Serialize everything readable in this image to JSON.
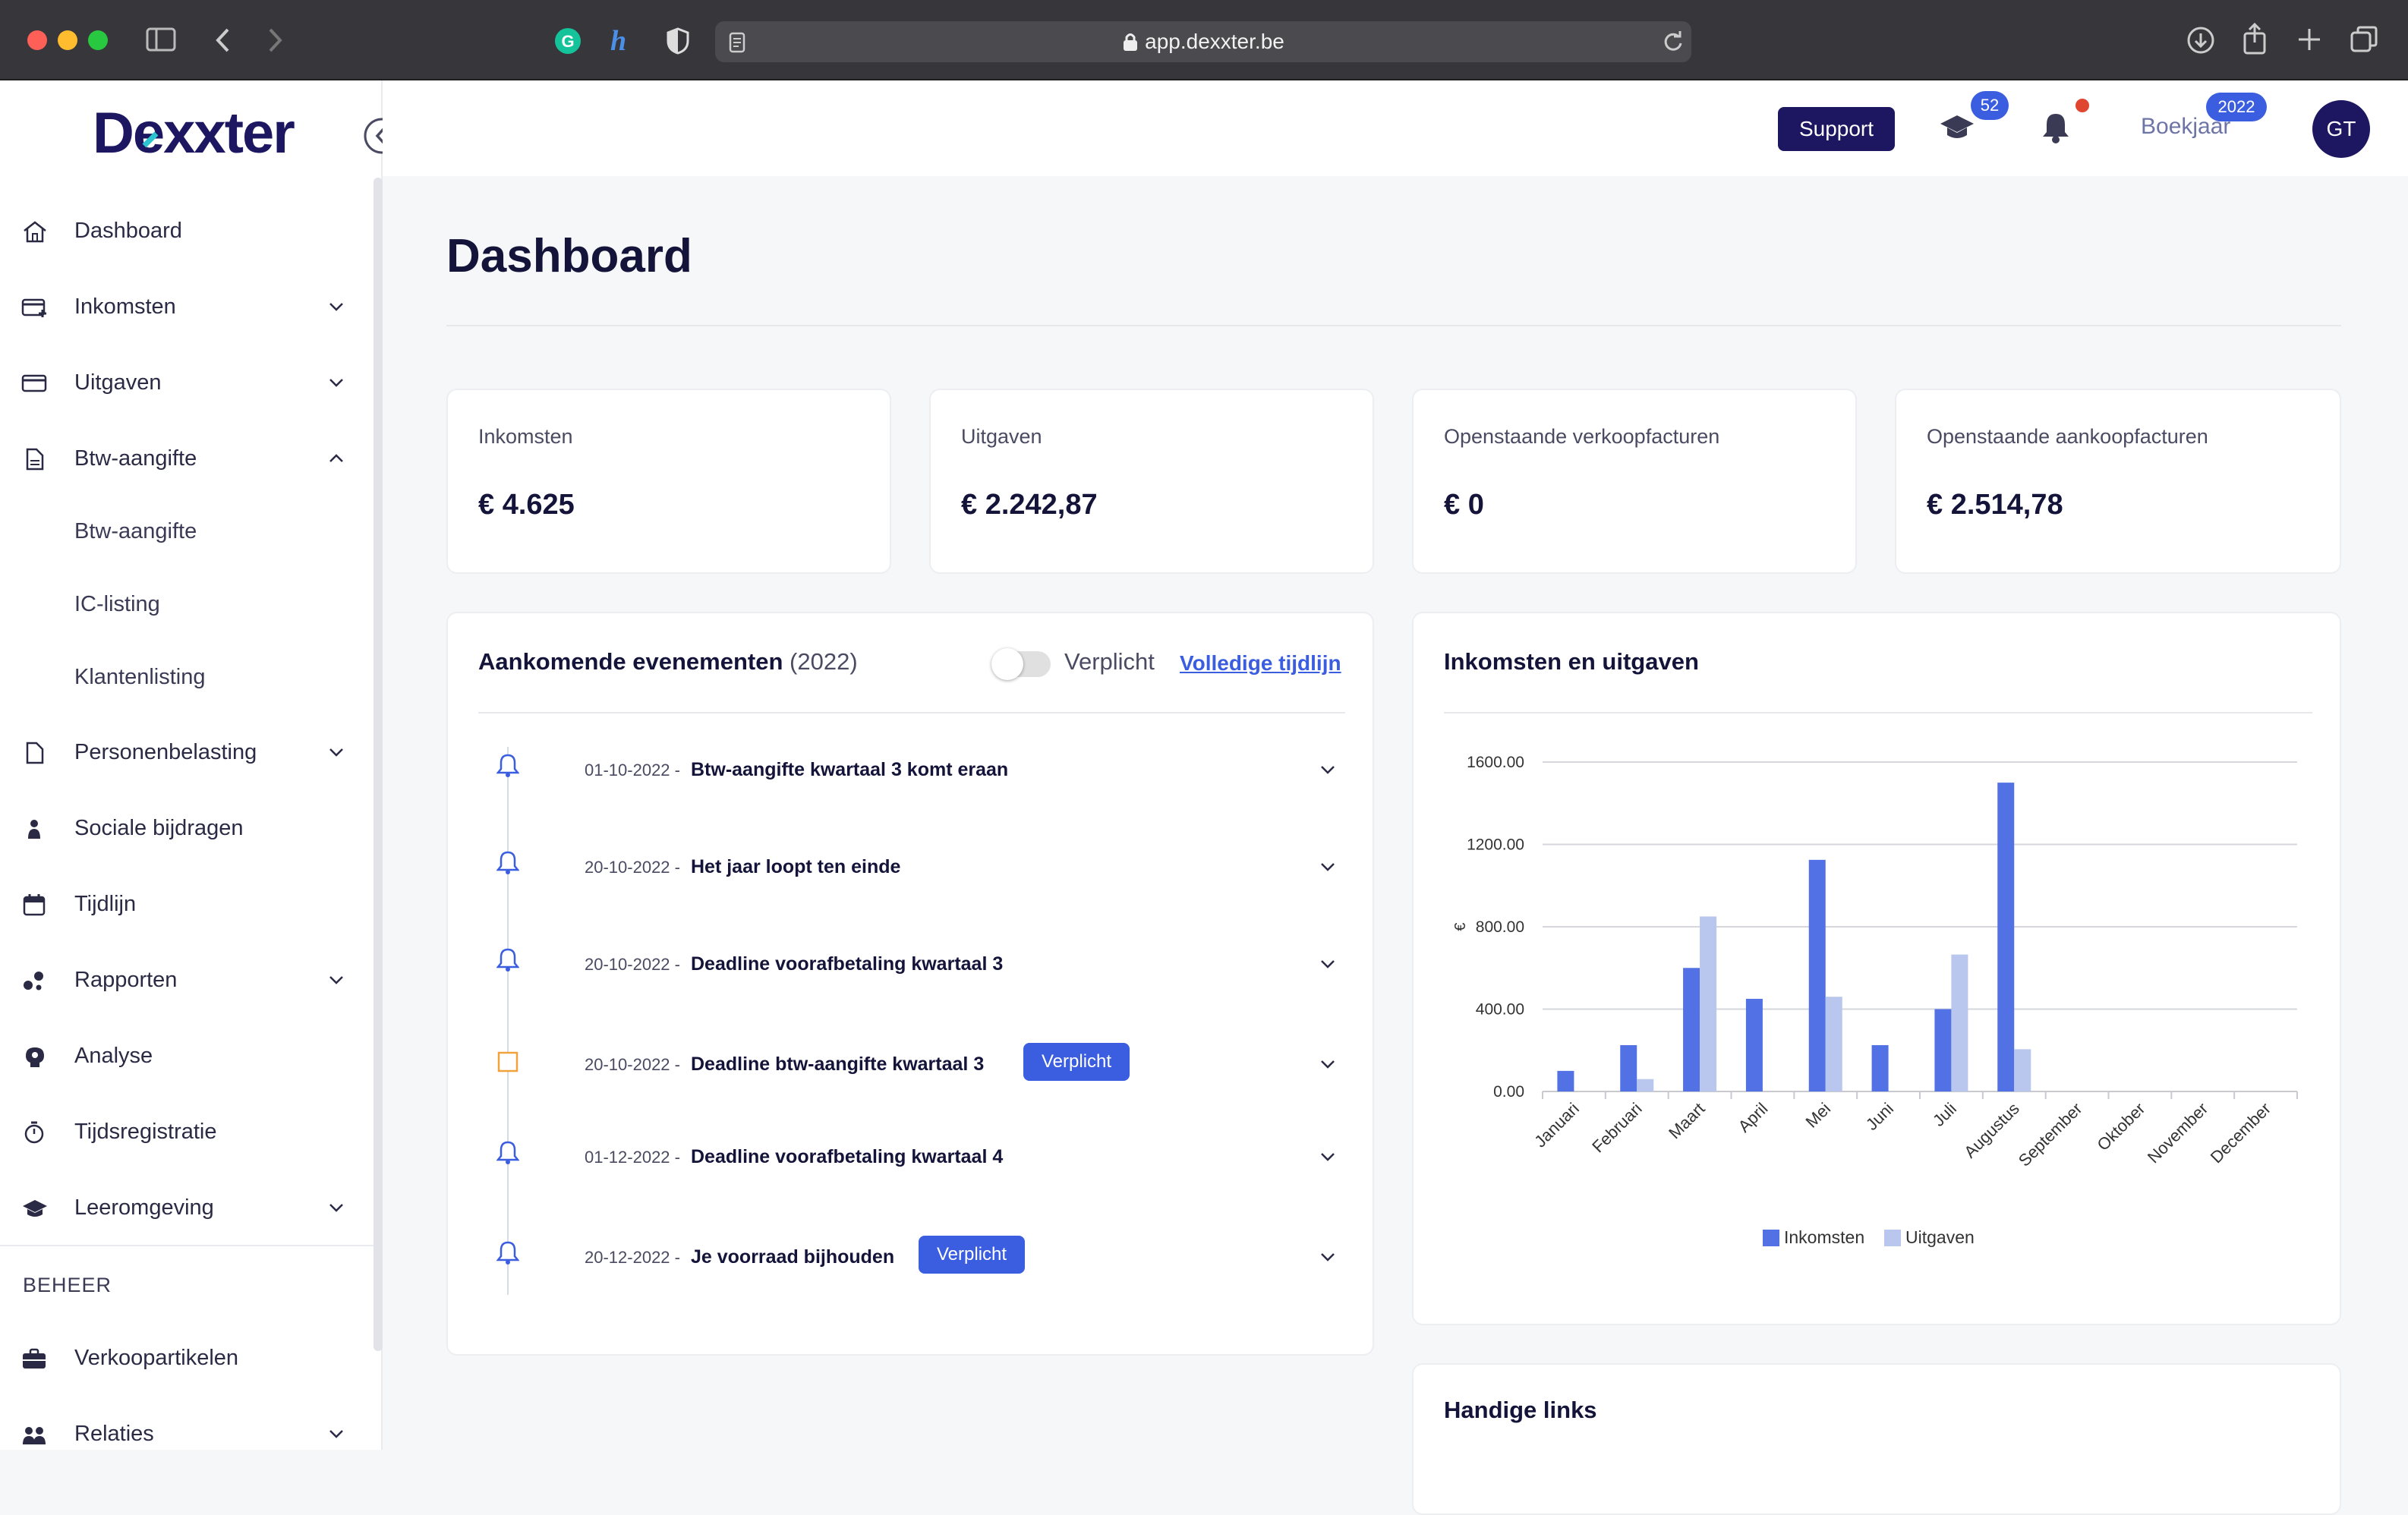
{
  "browser": {
    "url": "app.dexxter.be"
  },
  "brand": {
    "logo_text": "Dexxter",
    "colors": {
      "primary": "#1c1760",
      "accent": "#3b5ee0",
      "light_series": "#b9c6ee",
      "alert": "#e0452f",
      "teal": "#2cc4d0"
    }
  },
  "header": {
    "support_label": "Support",
    "learning_badge": "52",
    "bookyear_label": "Boekjaar",
    "bookyear_badge": "2022",
    "avatar_initials": "GT"
  },
  "sidebar": {
    "items": [
      {
        "label": "Dashboard",
        "icon": "home-icon"
      },
      {
        "label": "Inkomsten",
        "icon": "income-icon"
      },
      {
        "label": "Uitgaven",
        "icon": "card-icon"
      },
      {
        "label": "Btw-aangifte",
        "icon": "document-icon"
      },
      {
        "label": "Personenbelasting",
        "icon": "document-icon"
      },
      {
        "label": "Sociale bijdragen",
        "icon": "person-icon"
      },
      {
        "label": "Tijdlijn",
        "icon": "calendar-icon"
      },
      {
        "label": "Rapporten",
        "icon": "chart-icon"
      },
      {
        "label": "Analyse",
        "icon": "brain-icon"
      },
      {
        "label": "Tijdsregistratie",
        "icon": "stopwatch-icon"
      },
      {
        "label": "Leeromgeving",
        "icon": "graduation-cap-icon"
      }
    ],
    "btw_subitems": [
      "Btw-aangifte",
      "IC-listing",
      "Klantenlisting"
    ],
    "section_beheer": "BEHEER",
    "beheer_items": [
      {
        "label": "Verkoopartikelen",
        "icon": "briefcase-icon"
      },
      {
        "label": "Relaties",
        "icon": "people-icon"
      }
    ]
  },
  "page": {
    "title": "Dashboard"
  },
  "stats": [
    {
      "label": "Inkomsten",
      "value": "€ 4.625"
    },
    {
      "label": "Uitgaven",
      "value": "€ 2.242,87"
    },
    {
      "label": "Openstaande verkoopfacturen",
      "value": "€ 0"
    },
    {
      "label": "Openstaande aankoopfacturen",
      "value": "€ 2.514,78"
    }
  ],
  "events": {
    "title": "Aankomende evenementen",
    "year": "(2022)",
    "toggle_label": "Verplicht",
    "toggle_on": false,
    "timeline_link": "Volledige tijdlijn",
    "items": [
      {
        "date": "01-10-2022 -",
        "title": "Btw-aangifte kwartaal 3 komt eraan",
        "icon": "bell-icon",
        "badge": ""
      },
      {
        "date": "20-10-2022 -",
        "title": "Het jaar loopt ten einde",
        "icon": "bell-icon",
        "badge": ""
      },
      {
        "date": "20-10-2022 -",
        "title": "Deadline voorafbetaling kwartaal 3",
        "icon": "bell-icon",
        "badge": ""
      },
      {
        "date": "20-10-2022 -",
        "title": "Deadline btw-aangifte kwartaal 3",
        "icon": "checkbox-icon",
        "badge": "Verplicht"
      },
      {
        "date": "01-12-2022 -",
        "title": "Deadline voorafbetaling kwartaal 4",
        "icon": "bell-icon",
        "badge": ""
      },
      {
        "date": "20-12-2022 -",
        "title": "Je voorraad bijhouden",
        "icon": "bell-icon",
        "badge": "Verplicht"
      }
    ]
  },
  "chart_card": {
    "title": "Inkomsten en uitgaven"
  },
  "links_card": {
    "title": "Handige links"
  },
  "chart_data": {
    "type": "bar",
    "categories": [
      "Januari",
      "Februari",
      "Maart",
      "April",
      "Mei",
      "Juni",
      "Juli",
      "Augustus",
      "September",
      "Oktober",
      "November",
      "December"
    ],
    "series": [
      {
        "name": "Inkomsten",
        "values": [
          100,
          225,
          600,
          450,
          1125,
          225,
          400,
          1500,
          0,
          0,
          0,
          0
        ],
        "color": "#5171e4"
      },
      {
        "name": "Uitgaven",
        "values": [
          0,
          60,
          850,
          0,
          460,
          0,
          665,
          205,
          0,
          0,
          0,
          0
        ],
        "color": "#b9c6ee"
      }
    ],
    "ylabel": "€",
    "yticks": [
      "0.00",
      "400.00",
      "800.00",
      "1200.00",
      "1600.00"
    ],
    "ylim": [
      0,
      1600
    ],
    "grid": true,
    "legend": "bottom"
  }
}
